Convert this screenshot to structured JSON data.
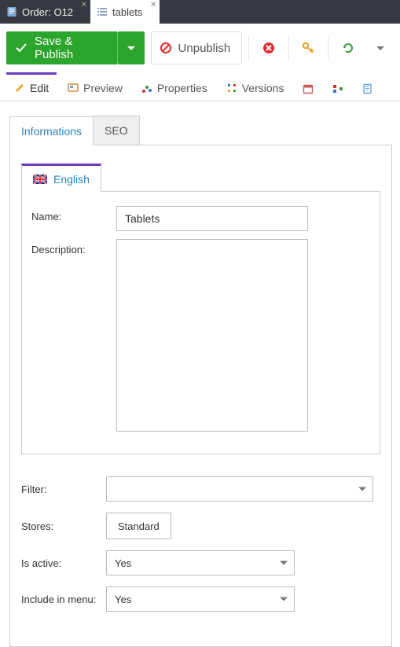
{
  "doc_tabs": [
    {
      "label": "Order: O12"
    },
    {
      "label": "tablets"
    }
  ],
  "toolbar": {
    "save_label": "Save & Publish",
    "unpublish_label": "Unpublish"
  },
  "view_tabs": {
    "edit": "Edit",
    "preview": "Preview",
    "properties": "Properties",
    "versions": "Versions"
  },
  "inner_tabs": {
    "informations": "Informations",
    "seo": "SEO"
  },
  "lang_tab": {
    "label": "English"
  },
  "form": {
    "name_label": "Name:",
    "name_value": "Tablets",
    "description_label": "Description:",
    "description_value": ""
  },
  "lower": {
    "filter_label": "Filter:",
    "filter_value": "",
    "stores_label": "Stores:",
    "stores_value": "Standard",
    "is_active_label": "Is active:",
    "is_active_value": "Yes",
    "include_menu_label": "Include in menu:",
    "include_menu_value": "Yes"
  }
}
